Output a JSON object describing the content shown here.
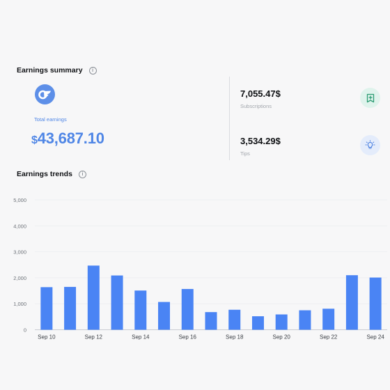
{
  "summary": {
    "title": "Earnings summary",
    "total_label": "Total earnings",
    "total_currency": "$",
    "total_value": "43,687.10",
    "subscriptions_value": "7,055.47$",
    "subscriptions_label": "Subscriptions",
    "tips_value": "3,534.29$",
    "tips_label": "Tips",
    "info_glyph": "i"
  },
  "trends": {
    "title": "Earnings trends",
    "info_glyph": "i"
  },
  "colors": {
    "accent": "#4f86e6",
    "bar": "#4a84f4",
    "green_icon": "#2b9b72",
    "blue_icon": "#4a7fe0"
  },
  "chart_data": {
    "type": "bar",
    "title": "",
    "xlabel": "",
    "ylabel": "",
    "ylim": [
      0,
      5000
    ],
    "yticks": [
      "0",
      "1,000",
      "2,000",
      "3,000",
      "4,000",
      "5,000"
    ],
    "categories": [
      "Sep 10",
      "Sep 11",
      "Sep 12",
      "Sep 13",
      "Sep 14",
      "Sep 15",
      "Sep 16",
      "Sep 17",
      "Sep 18",
      "Sep 19",
      "Sep 20",
      "Sep 21",
      "Sep 22",
      "Sep 23",
      "Sep 24"
    ],
    "x_tick_labels": [
      "Sep 10",
      "",
      "Sep 12",
      "",
      "Sep 14",
      "",
      "Sep 16",
      "",
      "Sep 18",
      "",
      "Sep 20",
      "",
      "Sep 22",
      "",
      "Sep 24"
    ],
    "values": [
      1640,
      1650,
      2470,
      2090,
      1510,
      1070,
      1570,
      680,
      770,
      520,
      590,
      750,
      810,
      2100,
      2010
    ],
    "grid": true
  }
}
